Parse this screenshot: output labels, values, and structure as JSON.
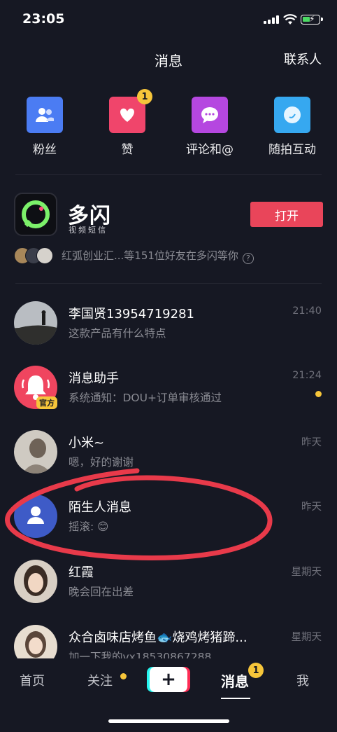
{
  "status_bar": {
    "time": "23:05"
  },
  "header": {
    "title": "消息",
    "contacts": "联系人"
  },
  "quick_actions": [
    {
      "label": "粉丝",
      "icon": "fans-icon",
      "color": "#4b7cf3",
      "badge": ""
    },
    {
      "label": "赞",
      "icon": "heart-icon",
      "color": "#f0456b",
      "badge": "1"
    },
    {
      "label": "评论和@",
      "icon": "comment-icon",
      "color": "#b547e0",
      "badge": ""
    },
    {
      "label": "随拍互动",
      "icon": "moment-icon",
      "color": "#36a8f0",
      "badge": ""
    }
  ],
  "promo": {
    "app_name": "多闪",
    "app_subtitle": "视频短信",
    "open_button": "打开",
    "friends_text": "红弧创业汇...等151位好友在多闪等你"
  },
  "conversations": [
    {
      "name": "李国贤13954719281",
      "preview": "这款产品有什么特点",
      "time": "21:40",
      "unread": false
    },
    {
      "name": "消息助手",
      "preview": "系统通知：DOU+订单审核通过",
      "time": "21:24",
      "unread": true,
      "tag": "官方"
    },
    {
      "name": "小米~",
      "preview": "嗯，好的谢谢",
      "time": "昨天",
      "unread": false
    },
    {
      "name": "陌生人消息",
      "preview": "摇滚: 😊",
      "time": "昨天",
      "unread": false
    },
    {
      "name": "红霞",
      "preview": "晚会回在出差",
      "time": "星期天",
      "unread": false
    },
    {
      "name": "众合卤味店烤鱼🐟烧鸡烤猪蹄...",
      "preview": "加一下我的vx18530867288",
      "time": "星期天",
      "unread": false
    }
  ],
  "tabbar": {
    "home": "首页",
    "follow": "关注",
    "messages": "消息",
    "messages_badge": "1",
    "me": "我"
  }
}
